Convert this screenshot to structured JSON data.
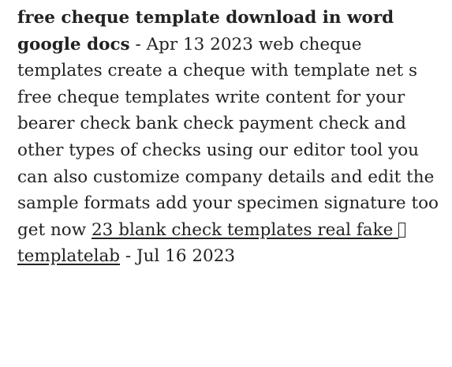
{
  "entry1": {
    "title": "free cheque template download in word google docs",
    "separator": " - ",
    "date": "Apr 13 2023",
    "body": "web cheque templates create a cheque with template net s free cheque templates write content for your bearer check bank check payment check and other types of checks using our editor tool you can also customize company details and edit the sample formats add your specimen signature too get now"
  },
  "entry2": {
    "link_text": "23 blank check templates real fake",
    "link_text_2": "templatelab",
    "separator": " - ",
    "date": "Jul 16 2023"
  }
}
